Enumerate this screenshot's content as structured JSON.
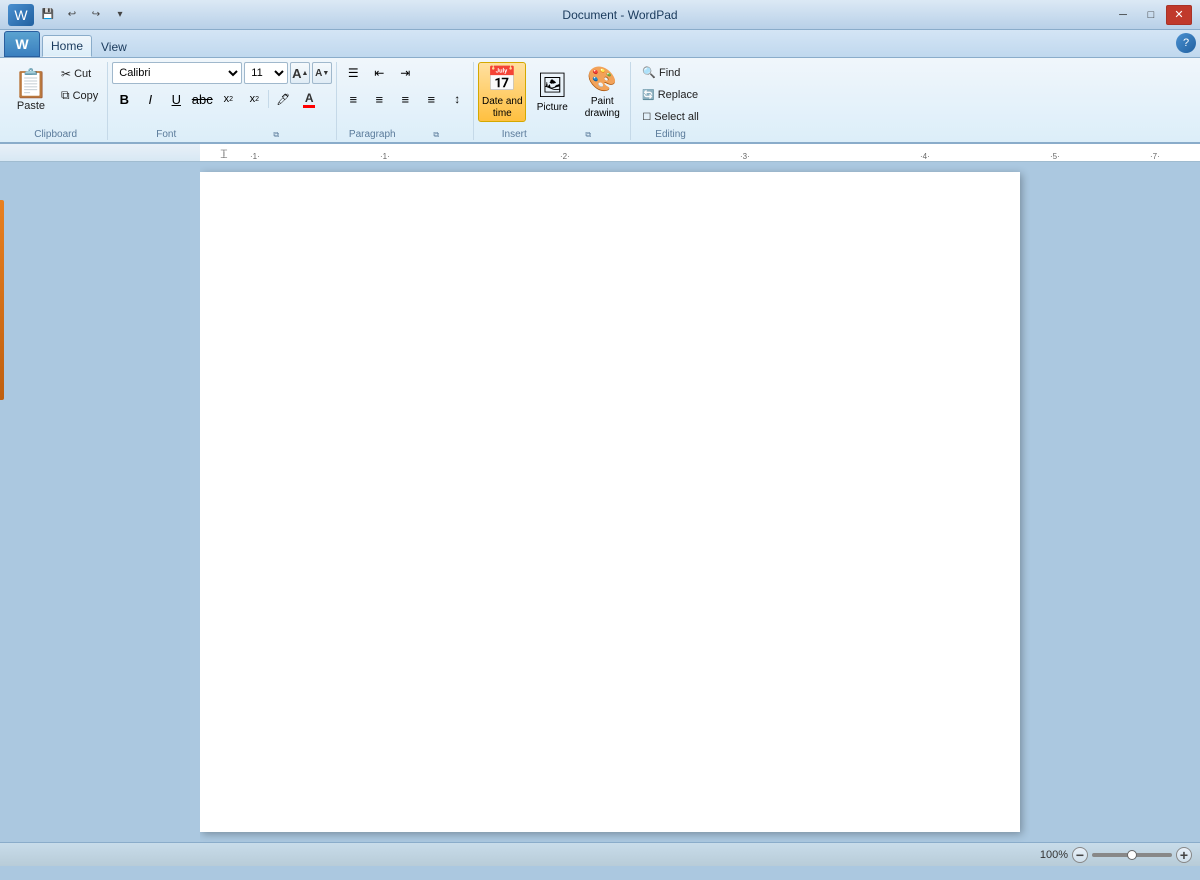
{
  "titlebar": {
    "title": "Document - WordPad",
    "minimize_label": "─",
    "maximize_label": "□",
    "close_label": "✕"
  },
  "quickaccess": {
    "save_label": "💾",
    "undo_label": "↩",
    "redo_label": "↪",
    "dropdown_label": "▾"
  },
  "tabs": {
    "home_label": "Home",
    "view_label": "View"
  },
  "ribbon": {
    "clipboard": {
      "group_label": "Clipboard",
      "paste_label": "Paste",
      "cut_label": "Cut",
      "copy_label": "Copy",
      "paste_icon": "📋",
      "cut_icon": "✂",
      "copy_icon": "⧉"
    },
    "font": {
      "group_label": "Font",
      "font_name": "Calibri",
      "font_size": "11",
      "bold_label": "B",
      "italic_label": "I",
      "underline_label": "U",
      "strikethrough_label": "abc",
      "subscript_label": "x₂",
      "superscript_label": "x²",
      "highlight_label": "🖊",
      "color_label": "A",
      "size_up_label": "A",
      "size_down_label": "A"
    },
    "paragraph": {
      "group_label": "Paragraph",
      "bullets_label": "☰",
      "decrease_indent_label": "⇤",
      "increase_indent_label": "⇥",
      "align_left_label": "≡",
      "align_center_label": "≡",
      "align_right_label": "≡",
      "justify_label": "≡",
      "line_spacing_label": "↕"
    },
    "insert": {
      "group_label": "Insert",
      "date_time_label": "Date and\ntime",
      "picture_label": "Picture",
      "paint_drawing_label": "Paint\ndrawing",
      "date_icon": "📅",
      "picture_icon": "🖼",
      "paint_icon": "🎨"
    },
    "editing": {
      "group_label": "Editing",
      "find_label": "Find",
      "replace_label": "Replace",
      "select_all_label": "Select all",
      "find_icon": "🔍",
      "replace_icon": "🔄",
      "select_all_icon": "☐"
    }
  },
  "statusbar": {
    "zoom_percent": "100%",
    "zoom_minus": "−",
    "zoom_plus": "+"
  },
  "help_icon": "?"
}
